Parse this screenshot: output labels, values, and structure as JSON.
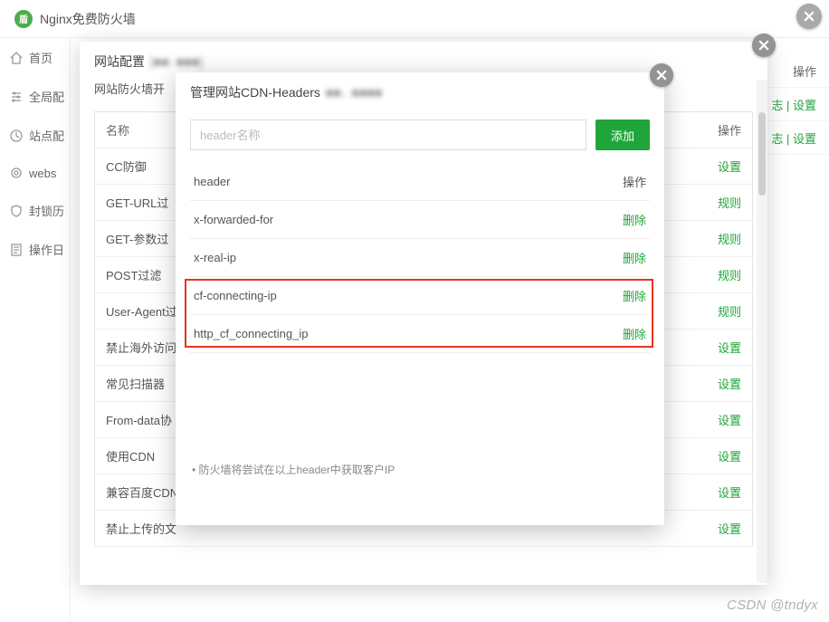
{
  "app": {
    "title": "Nginx免费防火墙"
  },
  "sidebar": {
    "items": [
      {
        "label": "首页",
        "icon": "home-icon"
      },
      {
        "label": "全局配",
        "icon": "sliders-icon"
      },
      {
        "label": "站点配",
        "icon": "clock-icon"
      },
      {
        "label": "webs",
        "icon": "gear-icon"
      },
      {
        "label": "封锁历",
        "icon": "shield-icon"
      },
      {
        "label": "操作日",
        "icon": "list-icon"
      }
    ]
  },
  "peek": {
    "header": "操作",
    "rows": [
      "志 | 设置",
      "志 | 设置"
    ]
  },
  "modal1": {
    "title_prefix": "网站配置",
    "title_blur": "[■■. ■■■]",
    "firewall_label": "网站防火墙开",
    "table": {
      "name_header": "名称",
      "action_header": "操作",
      "rows": [
        {
          "name": "CC防御",
          "action": "设置"
        },
        {
          "name": "GET-URL过",
          "action": "规则"
        },
        {
          "name": "GET-参数过",
          "action": "规则"
        },
        {
          "name": "POST过滤",
          "action": "规则"
        },
        {
          "name": "User-Agent过",
          "action": "规则"
        },
        {
          "name": "禁止海外访问",
          "action": "设置"
        },
        {
          "name": "常见扫描器",
          "action": "设置"
        },
        {
          "name": "From-data协",
          "action": "设置"
        },
        {
          "name": "使用CDN",
          "action": "设置"
        },
        {
          "name": "兼容百度CDN",
          "action": "设置"
        },
        {
          "name": "禁止上传的文",
          "action": "设置"
        }
      ]
    }
  },
  "modal2": {
    "title_prefix": "管理网站CDN-Headers",
    "title_blur": "■■.. ■■■■",
    "input_placeholder": "header名称",
    "add_btn": "添加",
    "table": {
      "name_header": "header",
      "action_header": "操作",
      "rows": [
        {
          "name": "x-forwarded-for",
          "action": "删除",
          "highlight": false
        },
        {
          "name": "x-real-ip",
          "action": "删除",
          "highlight": false
        },
        {
          "name": "cf-connecting-ip",
          "action": "删除",
          "highlight": true
        },
        {
          "name": "http_cf_connecting_ip",
          "action": "删除",
          "highlight": true
        }
      ]
    },
    "footer_note": "防火墙将尝试在以上header中获取客户IP"
  },
  "watermark": "CSDN @tndyx"
}
